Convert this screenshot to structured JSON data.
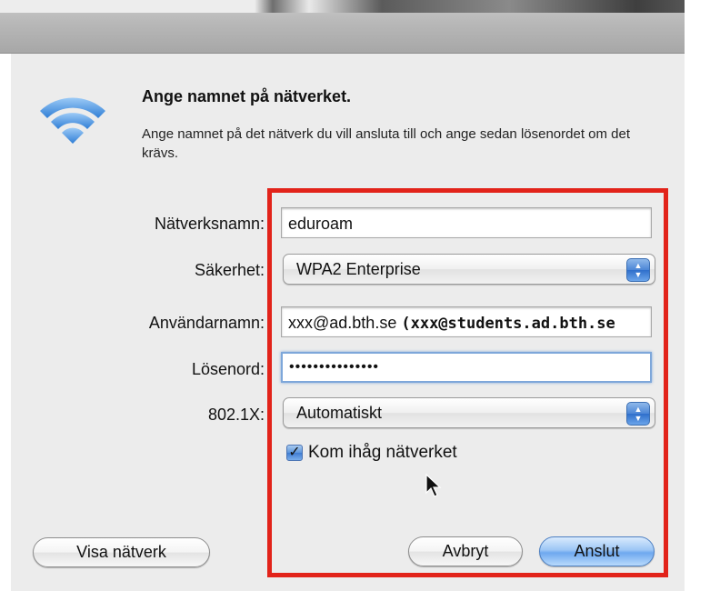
{
  "dialog": {
    "heading": "Ange namnet på nätverket.",
    "description": "Ange namnet på det nätverk du vill ansluta till och ange sedan lösenordet om det krävs."
  },
  "form": {
    "network_name_label": "Nätverksnamn:",
    "network_name_value": "eduroam",
    "security_label": "Säkerhet:",
    "security_value": "WPA2 Enterprise",
    "username_label": "Användarnamn:",
    "username_value": "xxx@ad.bth.se",
    "username_note": "(xxx@students.ad.bth.se",
    "password_label": "Lösenord:",
    "password_value": "•••••••••••••••",
    "eap_label": "802.1X:",
    "eap_value": "Automatiskt",
    "remember_label": "Kom ihåg nätverket",
    "remember_checked": true
  },
  "buttons": {
    "show_networks": "Visa nätverk",
    "cancel": "Avbryt",
    "connect": "Anslut"
  },
  "icons": {
    "wifi": "wifi-icon",
    "stepper": "stepper-icon",
    "checkmark": "checkmark-icon",
    "pointer": "mouse-pointer-icon"
  },
  "colors": {
    "highlight_frame": "#e2231a",
    "default_button": "#6ea8ef",
    "wifi_icon": "#3a87d8"
  }
}
